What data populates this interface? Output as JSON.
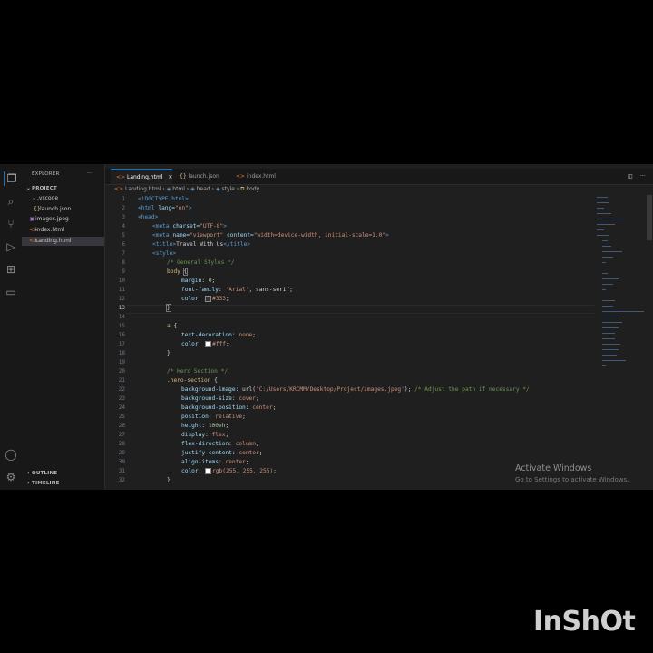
{
  "explorer": {
    "title": "EXPLORER",
    "menu_glyph": "···",
    "project": "PROJECT",
    "vscode_folder": ".vscode",
    "launch_json": "launch.json",
    "images_jpeg": "images.jpeg",
    "index_html": "index.html",
    "landing_html": "Landing.html",
    "outline": "OUTLINE",
    "timeline": "TIMELINE"
  },
  "tabs": {
    "landing": "Landing.html",
    "launch": "launch.json",
    "index": "index.html",
    "close_glyph": "×"
  },
  "breadcrumb": {
    "file": "Landing.html",
    "html": "html",
    "head": "head",
    "style": "style",
    "body": "body"
  },
  "editor": {
    "line_numbers": [
      "1",
      "2",
      "3",
      "4",
      "5",
      "6",
      "7",
      "8",
      "9",
      "10",
      "11",
      "12",
      "13",
      "14",
      "15",
      "16",
      "17",
      "18",
      "19",
      "20",
      "21",
      "22",
      "23",
      "24",
      "25",
      "26",
      "27",
      "28",
      "29",
      "30",
      "31",
      "32"
    ],
    "current_line": "13",
    "code": {
      "l1": "<!DOCTYPE html>",
      "l2a": "<html ",
      "l2b": "lang=",
      "l2c": "\"en\"",
      "l2d": ">",
      "l3": "<head>",
      "l4a": "<meta ",
      "l4b": "charset=",
      "l4c": "\"UTF-8\"",
      "l4d": ">",
      "l5a": "<meta ",
      "l5b": "name=",
      "l5c": "\"viewport\" ",
      "l5d": "content=",
      "l5e": "\"width=device-width, initial-scale=1.0\"",
      "l5f": ">",
      "l6a": "<title>",
      "l6b": "Travel With Us",
      "l6c": "</title>",
      "l7": "<style>",
      "l8": "/* General Styles */",
      "l9a": "body ",
      "l9b": "{",
      "l10a": "margin",
      "l10b": ": ",
      "l10c": "0",
      "l10d": ";",
      "l11a": "font-family",
      "l11b": ": ",
      "l11c": "'Arial'",
      "l11d": ", sans-serif;",
      "l12a": "color",
      "l12b": ": ",
      "l12c": "#333",
      "l12d": ";",
      "l13": "}",
      "l15a": "a ",
      "l15b": "{",
      "l16a": "text-decoration",
      "l16b": ": ",
      "l16c": "none",
      "l16d": ";",
      "l17a": "color",
      "l17b": ": ",
      "l17c": "#fff",
      "l17d": ";",
      "l18": "}",
      "l20": "/* Hero Section */",
      "l21a": ".hero-section ",
      "l21b": "{",
      "l22a": "background-image",
      "l22b": ": url(",
      "l22c": "'C:/Users/KRCMM/Desktop/Project/images.jpeg'",
      "l22d": "); ",
      "l22e": "/* Adjust the path if necessary */",
      "l23a": "background-size",
      "l23b": ": ",
      "l23c": "cover",
      "l23d": ";",
      "l24a": "background-position",
      "l24b": ": ",
      "l24c": "center",
      "l24d": ";",
      "l25a": "position",
      "l25b": ": ",
      "l25c": "relative",
      "l25d": ";",
      "l26a": "height",
      "l26b": ": ",
      "l26c": "100vh",
      "l26d": ";",
      "l27a": "display",
      "l27b": ": ",
      "l27c": "flex",
      "l27d": ";",
      "l28a": "flex-direction",
      "l28b": ": ",
      "l28c": "column",
      "l28d": ";",
      "l29a": "justify-content",
      "l29b": ": ",
      "l29c": "center",
      "l29d": ";",
      "l30a": "align-items",
      "l30b": ": ",
      "l30c": "center",
      "l30d": ";",
      "l31a": "color",
      "l31b": ": ",
      "l31c": "rgb(255, 255, 255)",
      "l31d": ";",
      "l32": "}"
    }
  },
  "watermark": {
    "title": "Activate Windows",
    "subtitle": "Go to Settings to activate Windows."
  },
  "brand": {
    "inshot": "InShOt"
  },
  "colors": {
    "accent": "#0078d4",
    "editor_bg": "#1f1f1f",
    "sidebar_bg": "#181818"
  }
}
